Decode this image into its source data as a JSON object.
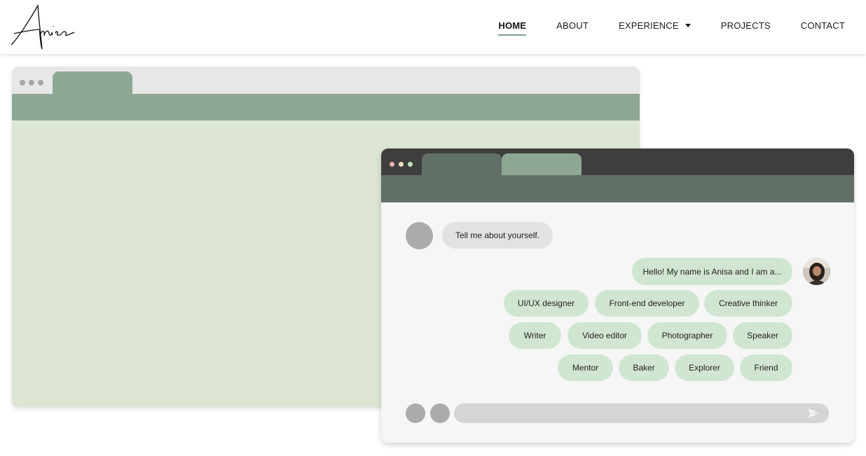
{
  "header": {
    "logo_text": "Anisa",
    "nav": [
      {
        "label": "HOME",
        "active": true
      },
      {
        "label": "ABOUT"
      },
      {
        "label": "EXPERIENCE",
        "has_dropdown": true
      },
      {
        "label": "PROJECTS"
      },
      {
        "label": "CONTACT"
      }
    ]
  },
  "chat": {
    "question": "Tell me about yourself.",
    "answer": "Hello! My name is Anisa and I am a...",
    "roles": [
      "UI/UX designer",
      "Front-end developer",
      "Creative thinker",
      "Writer",
      "Video editor",
      "Photographer",
      "Speaker",
      "Mentor",
      "Baker",
      "Explorer",
      "Friend"
    ]
  },
  "colors": {
    "sage": "#8ea794",
    "dark_sage": "#617066",
    "light_sage": "#dde6d4",
    "chip": "#d1e6d2",
    "dot_red": "#e8b4b0",
    "dot_yellow": "#e7e3b6",
    "dot_green": "#bfe3bf"
  },
  "icons": [
    "caret-down-icon",
    "send-icon"
  ]
}
